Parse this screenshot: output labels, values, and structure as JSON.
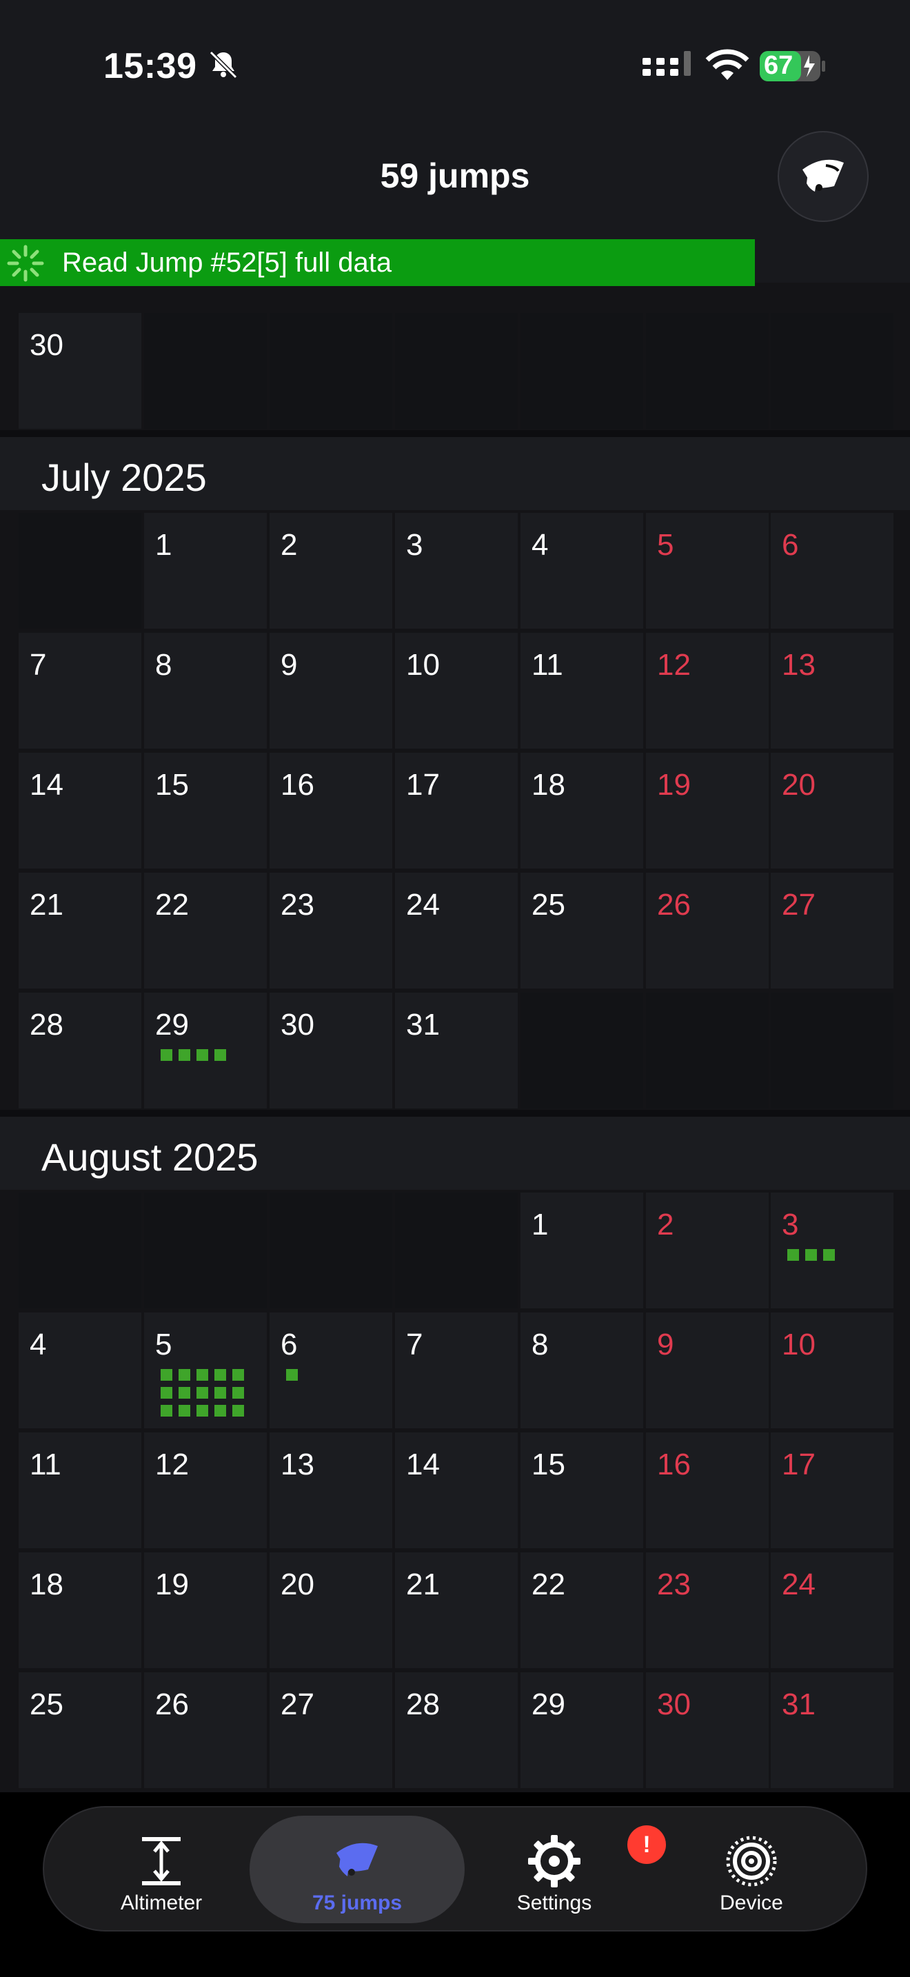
{
  "status_bar": {
    "time": "15:39",
    "battery": "67"
  },
  "header": {
    "title": "59 jumps"
  },
  "progress": {
    "text": "Read Jump #52[5] full data"
  },
  "months": [
    {
      "title": "July 2025"
    },
    {
      "title": "August 2025"
    }
  ],
  "june_tail": {
    "day": "30"
  },
  "july_days": [
    "1",
    "2",
    "3",
    "4",
    "5",
    "6",
    "7",
    "8",
    "9",
    "10",
    "11",
    "12",
    "13",
    "14",
    "15",
    "16",
    "17",
    "18",
    "19",
    "20",
    "21",
    "22",
    "23",
    "24",
    "25",
    "26",
    "27",
    "28",
    "29",
    "30",
    "31"
  ],
  "august_days": [
    "1",
    "2",
    "3",
    "4",
    "5",
    "6",
    "7",
    "8",
    "9",
    "10",
    "11",
    "12",
    "13",
    "14",
    "15",
    "16",
    "17",
    "18",
    "19",
    "20",
    "21",
    "22",
    "23",
    "24",
    "25",
    "26",
    "27",
    "28",
    "29",
    "30",
    "31"
  ],
  "jump_counts": {
    "july_29": 4,
    "august_3": 3,
    "august_5": 15,
    "august_6": 1
  },
  "tabbar": {
    "altimeter": "Altimeter",
    "jumps": "75 jumps",
    "settings": "Settings",
    "settings_badge": "!",
    "device": "Device"
  },
  "colors": {
    "weekend": "#e03b4f",
    "jump_marker": "#3fa52a",
    "progress": "#0b9c11",
    "active_tab": "#5b6cf0"
  }
}
